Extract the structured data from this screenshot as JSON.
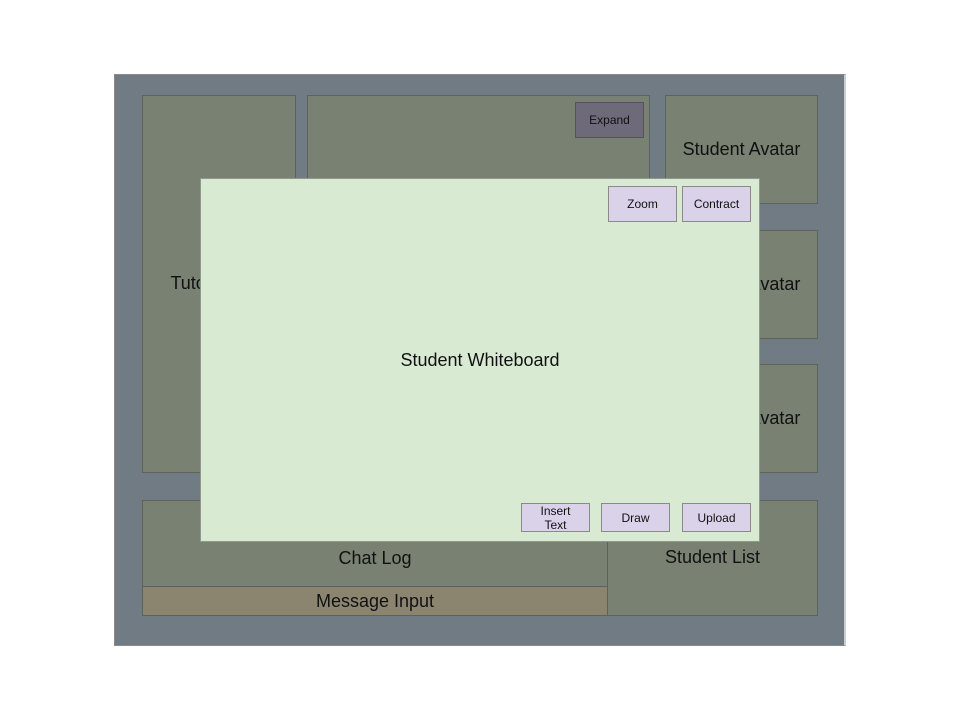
{
  "panels": {
    "tutor_avatar": "Tutor Avatar",
    "student_avatars": [
      "Student Avatar",
      "Student Avatar",
      "Student Avatar"
    ],
    "chat_log": "Chat Log",
    "message_input": "Message Input",
    "student_list": "Student List",
    "expand_label": "Expand"
  },
  "whiteboard": {
    "title": "Student Whiteboard",
    "zoom_label": "Zoom",
    "contract_label": "Contract",
    "insert_text_label": "Insert Text",
    "draw_label": "Draw",
    "upload_label": "Upload"
  },
  "colors": {
    "frame": "#717b84",
    "panel": "#788172",
    "message_input": "#8b8570",
    "whiteboard": "#d9ead3",
    "button": "#d9d2e9",
    "expand_button": "#6e6a7a"
  }
}
